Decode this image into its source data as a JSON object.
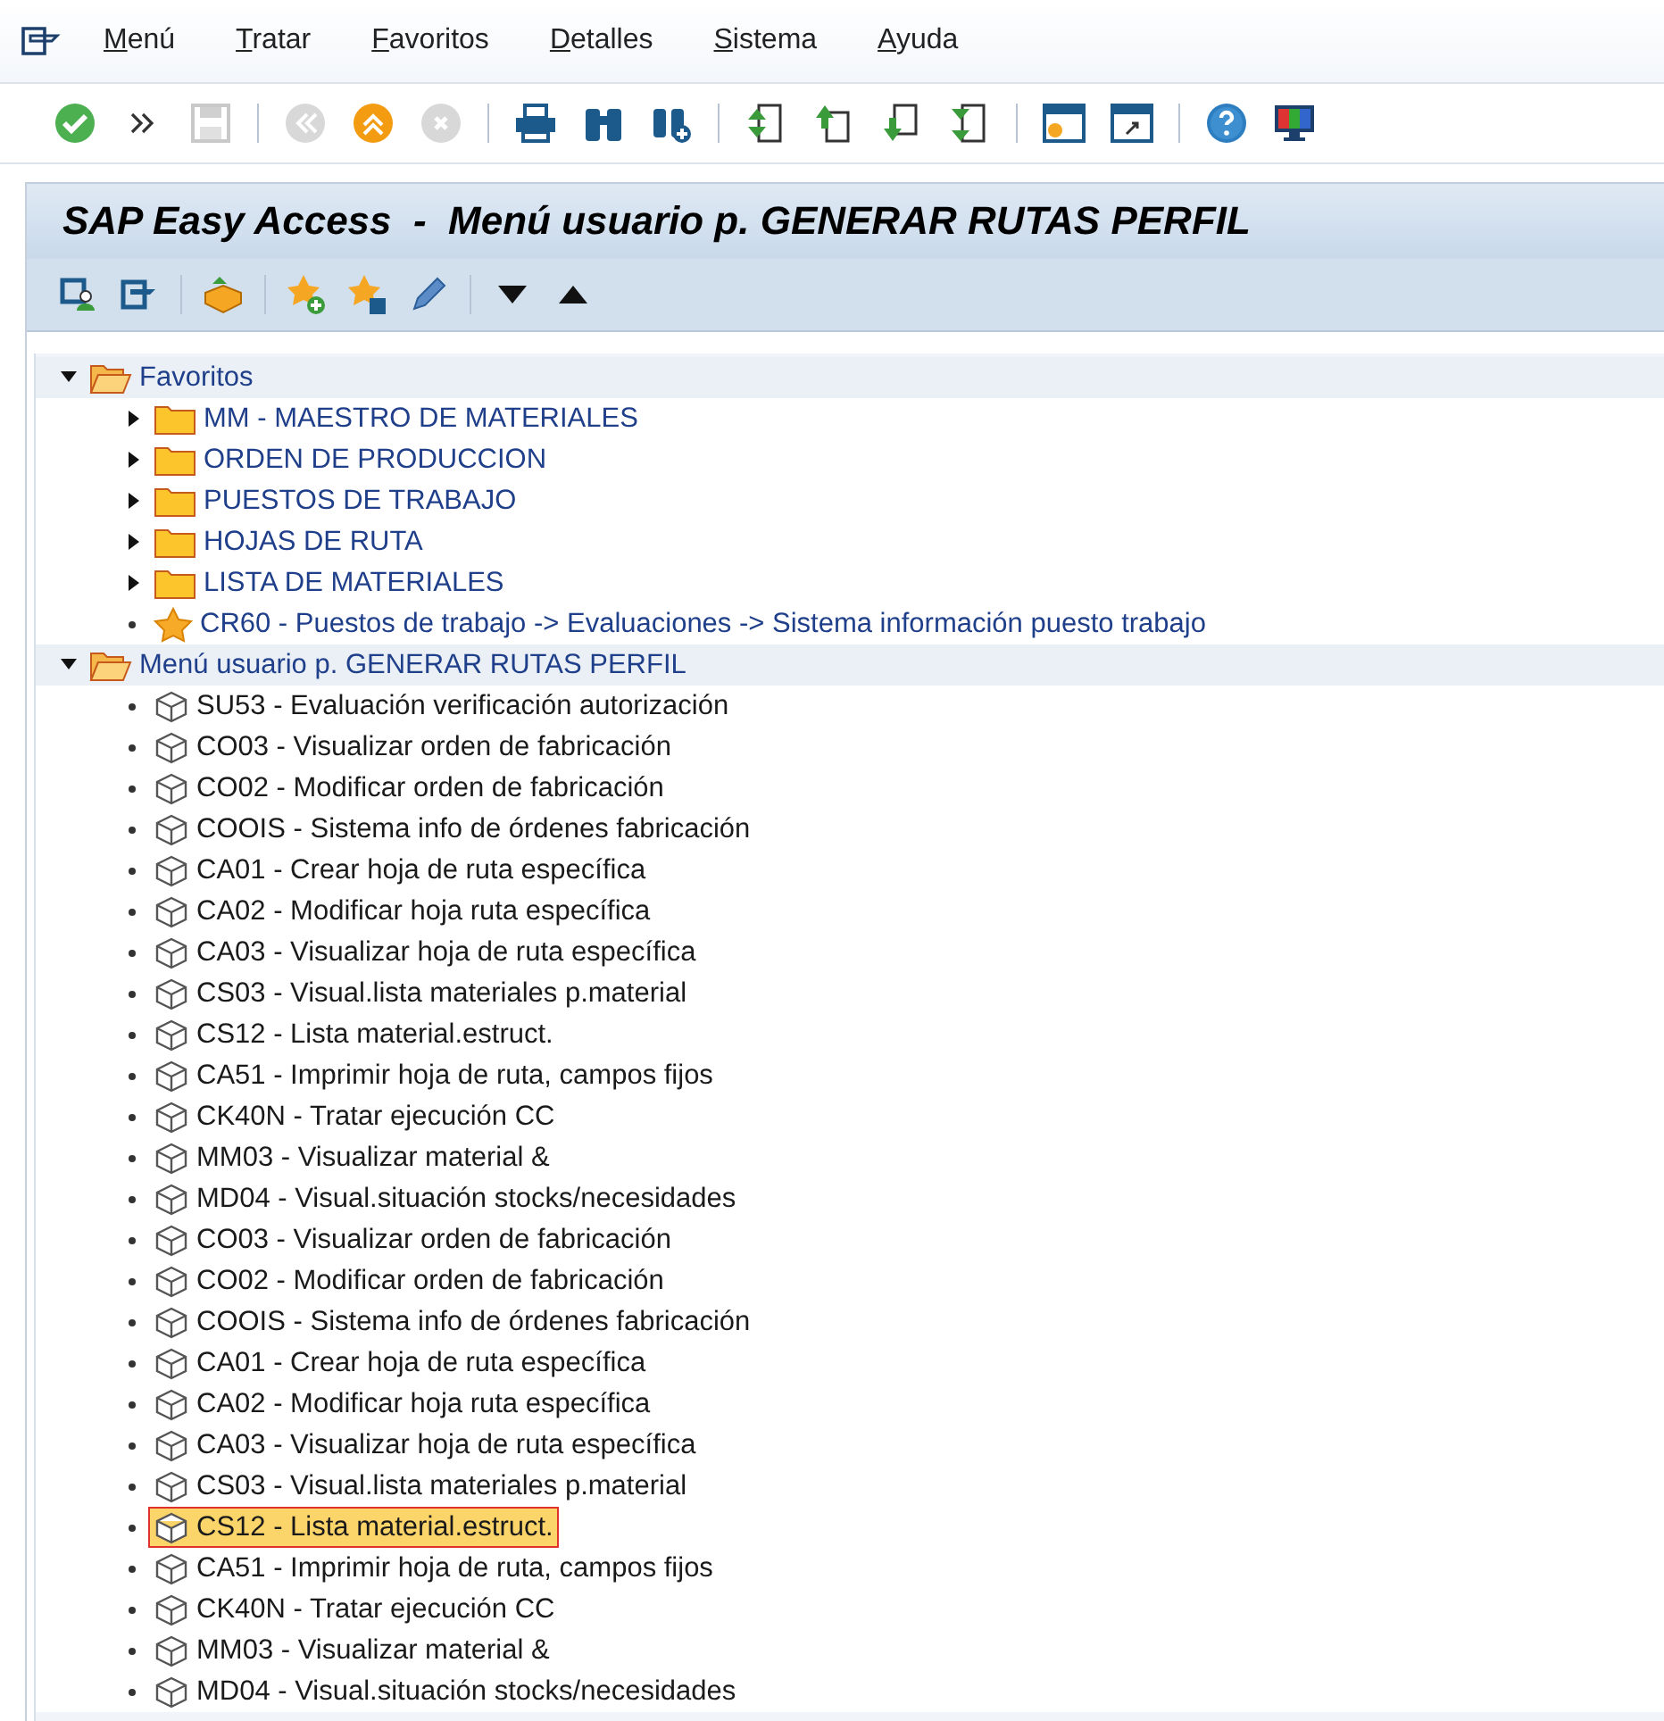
{
  "menu_bar": [
    "Menú",
    "Tratar",
    "Favoritos",
    "Detalles",
    "Sistema",
    "Ayuda"
  ],
  "toolbar": [
    {
      "kind": "enter",
      "disabled": false
    },
    {
      "kind": "more",
      "disabled": false
    },
    {
      "kind": "save",
      "disabled": true
    },
    {
      "kind": "separator"
    },
    {
      "kind": "back",
      "disabled": true
    },
    {
      "kind": "exit",
      "disabled": false
    },
    {
      "kind": "cancel",
      "disabled": true
    },
    {
      "kind": "separator"
    },
    {
      "kind": "print",
      "disabled": false
    },
    {
      "kind": "find",
      "disabled": false
    },
    {
      "kind": "findnext",
      "disabled": false
    },
    {
      "kind": "separator"
    },
    {
      "kind": "first",
      "disabled": false
    },
    {
      "kind": "prev",
      "disabled": false
    },
    {
      "kind": "next",
      "disabled": false
    },
    {
      "kind": "last",
      "disabled": false
    },
    {
      "kind": "separator"
    },
    {
      "kind": "newsession",
      "disabled": false
    },
    {
      "kind": "shortcut",
      "disabled": false
    },
    {
      "kind": "separator"
    },
    {
      "kind": "help",
      "disabled": false
    },
    {
      "kind": "layout",
      "disabled": false
    }
  ],
  "title": "SAP Easy Access  -  Menú usuario p. GENERAR RUTAS PERFIL",
  "app_toolbar": [
    {
      "kind": "usermenu"
    },
    {
      "kind": "sapmenu"
    },
    {
      "kind": "separator"
    },
    {
      "kind": "other"
    },
    {
      "kind": "separator"
    },
    {
      "kind": "addfav"
    },
    {
      "kind": "delfav"
    },
    {
      "kind": "edit"
    },
    {
      "kind": "separator"
    },
    {
      "kind": "down"
    },
    {
      "kind": "up"
    }
  ],
  "tree": [
    {
      "kind": "root",
      "label": "Favoritos",
      "expanded": true,
      "selected": false,
      "children": [
        {
          "kind": "folder",
          "label": "MM - MAESTRO DE MATERIALES",
          "expanded": false,
          "selected": false
        },
        {
          "kind": "folder",
          "label": "ORDEN DE PRODUCCION",
          "expanded": false,
          "selected": false
        },
        {
          "kind": "folder",
          "label": "PUESTOS DE TRABAJO",
          "expanded": false,
          "selected": false
        },
        {
          "kind": "folder",
          "label": "HOJAS DE RUTA",
          "expanded": false,
          "selected": false
        },
        {
          "kind": "folder",
          "label": "LISTA DE MATERIALES",
          "expanded": false,
          "selected": false
        },
        {
          "kind": "favorite",
          "label": "CR60 - Puestos de trabajo -> Evaluaciones -> Sistema información puesto trabajo",
          "selected": false
        }
      ]
    },
    {
      "kind": "root",
      "label": "Menú usuario p. GENERAR RUTAS PERFIL",
      "expanded": true,
      "selected": false,
      "children": [
        {
          "kind": "transaction",
          "label": "SU53 - Evaluación verificación autorización",
          "selected": false
        },
        {
          "kind": "transaction",
          "label": "CO03 - Visualizar orden de fabricación",
          "selected": false
        },
        {
          "kind": "transaction",
          "label": "CO02 - Modificar orden de fabricación",
          "selected": false
        },
        {
          "kind": "transaction",
          "label": "COOIS - Sistema info de órdenes fabricación",
          "selected": false
        },
        {
          "kind": "transaction",
          "label": "CA01 - Crear hoja de ruta específica",
          "selected": false
        },
        {
          "kind": "transaction",
          "label": "CA02 - Modificar hoja ruta específica",
          "selected": false
        },
        {
          "kind": "transaction",
          "label": "CA03 - Visualizar hoja de ruta específica",
          "selected": false
        },
        {
          "kind": "transaction",
          "label": "CS03 - Visual.lista materiales p.material",
          "selected": false
        },
        {
          "kind": "transaction",
          "label": "CS12 - Lista material.estruct.",
          "selected": false
        },
        {
          "kind": "transaction",
          "label": "CA51 - Imprimir hoja de ruta, campos fijos",
          "selected": false
        },
        {
          "kind": "transaction",
          "label": "CK40N - Tratar ejecución CC",
          "selected": false
        },
        {
          "kind": "transaction",
          "label": "MM03 - Visualizar material &",
          "selected": false
        },
        {
          "kind": "transaction",
          "label": "MD04 - Visual.situación stocks/necesidades",
          "selected": false
        },
        {
          "kind": "transaction",
          "label": "CO03 - Visualizar orden de fabricación",
          "selected": false
        },
        {
          "kind": "transaction",
          "label": "CO02 - Modificar orden de fabricación",
          "selected": false
        },
        {
          "kind": "transaction",
          "label": "COOIS - Sistema info de órdenes fabricación",
          "selected": false
        },
        {
          "kind": "transaction",
          "label": "CA01 - Crear hoja de ruta específica",
          "selected": false
        },
        {
          "kind": "transaction",
          "label": "CA02 - Modificar hoja ruta específica",
          "selected": false
        },
        {
          "kind": "transaction",
          "label": "CA03 - Visualizar hoja de ruta específica",
          "selected": false
        },
        {
          "kind": "transaction",
          "label": "CS03 - Visual.lista materiales p.material",
          "selected": false
        },
        {
          "kind": "transaction",
          "label": "CS12 - Lista material.estruct.",
          "selected": true
        },
        {
          "kind": "transaction",
          "label": "CA51 - Imprimir hoja de ruta, campos fijos",
          "selected": false
        },
        {
          "kind": "transaction",
          "label": "CK40N - Tratar ejecución CC",
          "selected": false
        },
        {
          "kind": "transaction",
          "label": "MM03 - Visualizar material &",
          "selected": false
        },
        {
          "kind": "transaction",
          "label": "MD04 - Visual.situación stocks/necesidades",
          "selected": false
        }
      ]
    }
  ]
}
